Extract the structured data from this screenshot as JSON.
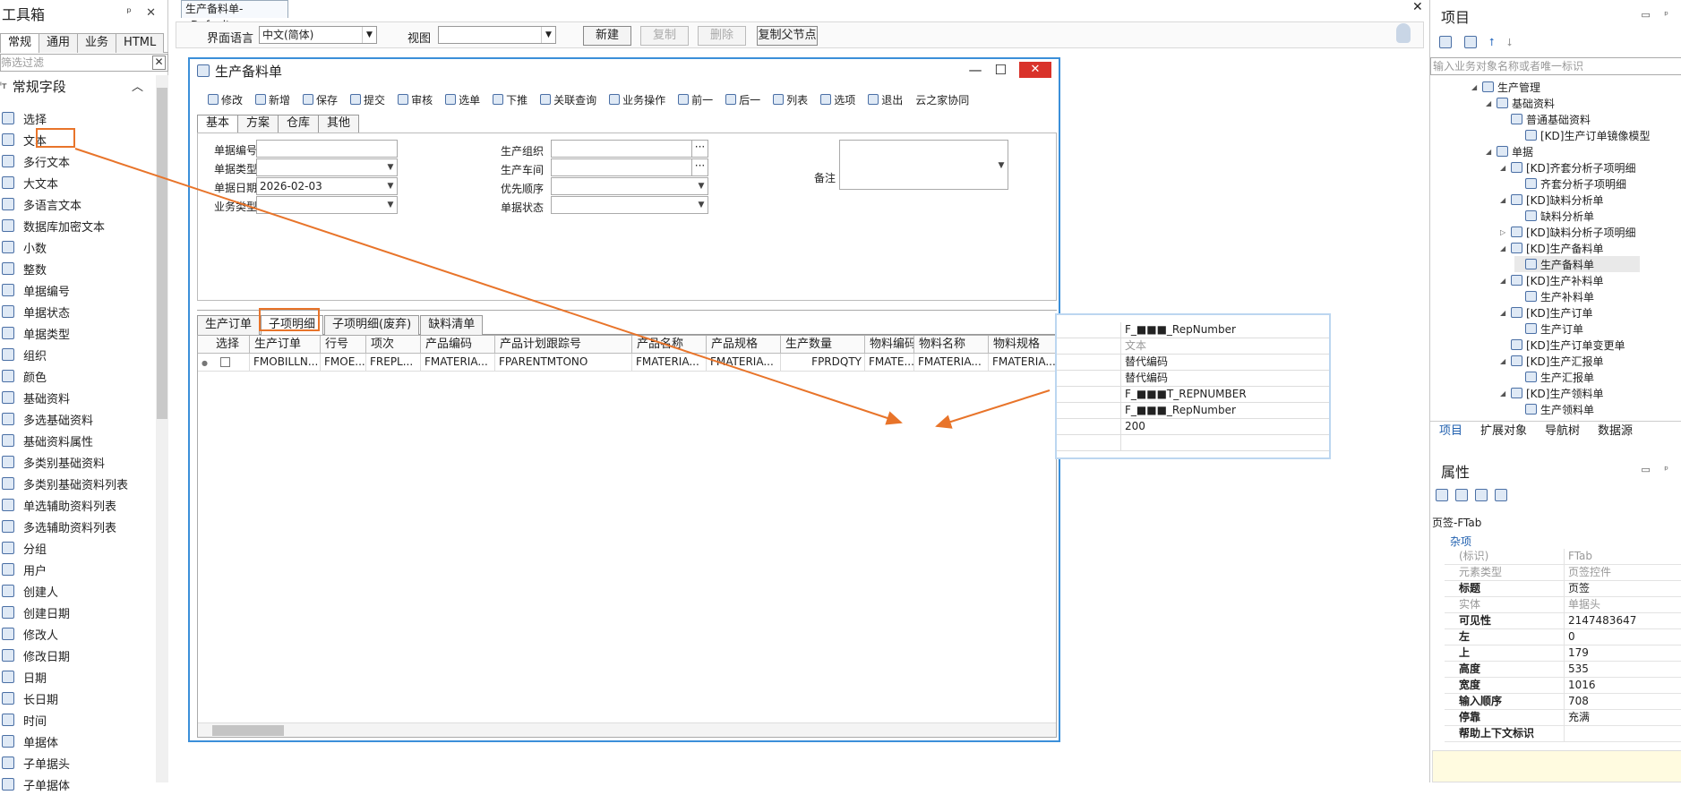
{
  "toolbox": {
    "title": "工具箱",
    "tabs": [
      "常规",
      "通用",
      "业务",
      "HTML"
    ],
    "filter_placeholder": "筛选过滤",
    "group": "常规字段",
    "items": [
      "选择",
      "文本",
      "多行文本",
      "大文本",
      "多语言文本",
      "数据库加密文本",
      "小数",
      "整数",
      "单据编号",
      "单据状态",
      "单据类型",
      "组织",
      "颜色",
      "基础资料",
      "多选基础资料",
      "基础资料属性",
      "多类别基础资料",
      "多类别基础资料列表",
      "单选辅助资料列表",
      "多选辅助资料列表",
      "分组",
      "用户",
      "创建人",
      "创建日期",
      "修改人",
      "修改日期",
      "日期",
      "长日期",
      "时间",
      "单据体",
      "子单据头",
      "子单据体"
    ]
  },
  "document_tab": "生产备料单-_Default",
  "top_toolbar": {
    "lang_label": "界面语言",
    "lang_value": "中文(简体)",
    "view_label": "视图",
    "view_value": "",
    "buttons": [
      "新建",
      "复制",
      "删除",
      "复制父节点"
    ]
  },
  "form": {
    "title": "生产备料单",
    "toolbar": [
      "修改",
      "新增",
      "保存",
      "提交",
      "审核",
      "选单",
      "下推",
      "关联查询",
      "业务操作",
      "前一",
      "后一",
      "列表",
      "选项",
      "退出",
      "云之家协同"
    ],
    "tabs": [
      "基本",
      "方案",
      "仓库",
      "其他"
    ],
    "fields": {
      "bill_no": {
        "label": "单据编号",
        "value": ""
      },
      "bill_type": {
        "label": "单据类型",
        "value": ""
      },
      "bill_date": {
        "label": "单据日期",
        "value": "2026-02-03"
      },
      "biz_type": {
        "label": "业务类型",
        "value": ""
      },
      "prd_org": {
        "label": "生产组织",
        "value": ""
      },
      "workshop": {
        "label": "生产车间",
        "value": ""
      },
      "priority": {
        "label": "优先顺序",
        "value": ""
      },
      "status": {
        "label": "单据状态",
        "value": ""
      },
      "remark": {
        "label": "备注",
        "value": ""
      }
    },
    "entry_tabs": [
      "生产订单",
      "子项明细",
      "子项明细(废弃)",
      "缺料清单"
    ],
    "grid_headers": [
      "选择",
      "生产订单",
      "行号",
      "项次",
      "产品编码",
      "产品计划跟踪号",
      "产品名称",
      "产品规格",
      "生产数量",
      "物料编码",
      "物料名称",
      "物料规格"
    ],
    "grid_row": [
      "",
      "FMOBILLN...",
      "FMOE...",
      "FREPL...",
      "FMATERIA...",
      "FPARENTMTONO",
      "FMATERIA...",
      "FMATERIA...",
      "FPRDQTY",
      "FMATE...",
      "FMATERIA...",
      "FMATERIA..."
    ]
  },
  "popup": {
    "rows": [
      "F_■■■_RepNumber",
      "文本",
      "替代编码",
      "替代编码",
      "F_■■■T_REPNUMBER",
      "F_■■■_RepNumber",
      "200",
      ""
    ]
  },
  "project": {
    "title": "项目",
    "search_placeholder": "输入业务对象名称或者唯一标识",
    "tree": [
      "生产管理",
      "基础资料",
      "普通基础资料",
      "[KD]生产订单镜像模型",
      "单据",
      "[KD]齐套分析子项明细",
      "齐套分析子项明细",
      "[KD]缺料分析单",
      "缺料分析单",
      "[KD]缺料分析子项明细",
      "[KD]生产备料单",
      "生产备料单",
      "[KD]生产补料单",
      "生产补料单",
      "[KD]生产订单",
      "生产订单",
      "[KD]生产订单变更单",
      "[KD]生产汇报单",
      "生产汇报单",
      "[KD]生产领料单",
      "生产领料单"
    ],
    "tabs": [
      "项目",
      "扩展对象",
      "导航树",
      "数据源"
    ]
  },
  "properties": {
    "title": "属性",
    "caption": "页签-FTab",
    "category": "杂项",
    "rows": [
      {
        "name": "(标识)",
        "value": "FTab"
      },
      {
        "name": "元素类型",
        "value": "页签控件"
      },
      {
        "name": "标题",
        "value": "页签"
      },
      {
        "name": "实体",
        "value": "单据头"
      },
      {
        "name": "可见性",
        "value": "2147483647"
      },
      {
        "name": "左",
        "value": "0"
      },
      {
        "name": "上",
        "value": "179"
      },
      {
        "name": "高度",
        "value": "535"
      },
      {
        "name": "宽度",
        "value": "1016"
      },
      {
        "name": "输入顺序",
        "value": "708"
      },
      {
        "name": "停靠",
        "value": "充满"
      },
      {
        "name": "帮助上下文标识",
        "value": ""
      }
    ]
  },
  "colors": {
    "accent": "#e8742a",
    "frame": "#3b8fd9",
    "close": "#d9322a"
  }
}
